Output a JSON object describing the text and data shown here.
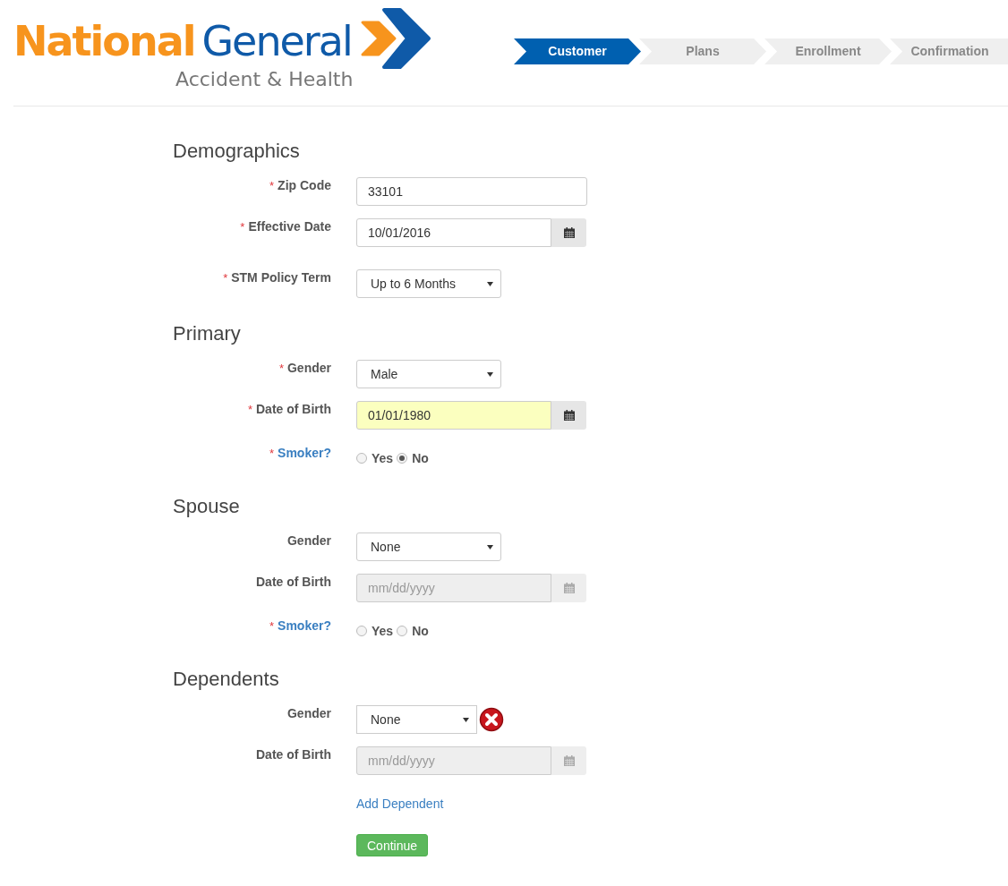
{
  "logo": {
    "name_first": "National",
    "name_second": "General",
    "tagline": "Accident & Health"
  },
  "steps": [
    {
      "label": "Customer",
      "selected": true
    },
    {
      "label": "Plans",
      "selected": false
    },
    {
      "label": "Enrollment",
      "selected": false
    },
    {
      "label": "Confirmation",
      "selected": false
    }
  ],
  "sections": [
    {
      "title": "Demographics",
      "rows": [
        {
          "kind": "text",
          "required_mark": "*",
          "label": "Zip Code",
          "value": "33101"
        },
        {
          "kind": "date",
          "required_mark": "*",
          "label": "Effective Date",
          "value": "10/01/2016",
          "disabled": false
        },
        {
          "kind": "select",
          "required_mark": "*",
          "label": "STM Policy Term",
          "value": "Up to 6 Months"
        }
      ]
    },
    {
      "title": "Primary",
      "rows": [
        {
          "kind": "select",
          "required_mark": "*",
          "label": "Gender",
          "value": "Male"
        },
        {
          "kind": "date",
          "required_mark": "*",
          "label": "Date of Birth",
          "value": "01/01/1980",
          "highlighted": true,
          "disabled": false
        },
        {
          "kind": "radio",
          "required_mark": "*",
          "label": "Smoker?",
          "options": [
            {
              "label": "Yes",
              "selected": false
            },
            {
              "label": "No",
              "selected": true
            }
          ]
        }
      ]
    },
    {
      "title": "Spouse",
      "rows": [
        {
          "kind": "select",
          "label": "Gender",
          "value": "None"
        },
        {
          "kind": "date",
          "label": "Date of Birth",
          "placeholder": "mm/dd/yyyy",
          "disabled": true
        },
        {
          "kind": "radio",
          "required_mark": "*",
          "label": "Smoker?",
          "options": [
            {
              "label": "Yes",
              "selected": false
            },
            {
              "label": "No",
              "selected": false
            }
          ]
        }
      ]
    },
    {
      "title": "Dependents",
      "rows": [
        {
          "kind": "select",
          "label": "Gender",
          "value": "None",
          "removable": true
        },
        {
          "kind": "date",
          "label": "Date of Birth",
          "placeholder": "mm/dd/yyyy",
          "disabled": true
        },
        {
          "kind": "link",
          "label": "Add Dependent"
        }
      ]
    }
  ],
  "continue_button": "Continue"
}
